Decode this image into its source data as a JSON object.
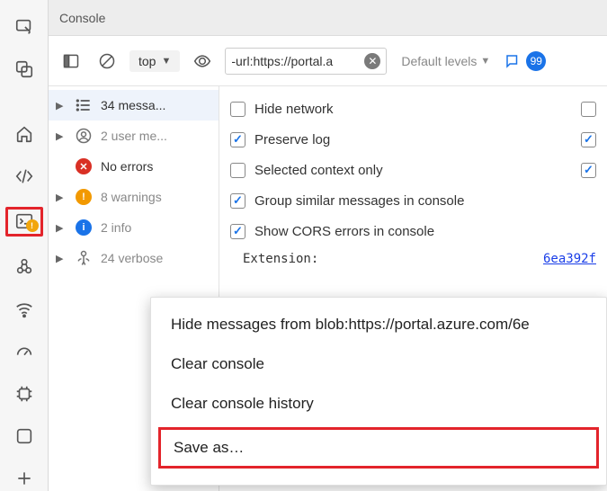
{
  "title": "Console",
  "toolbar": {
    "context": "top",
    "filter_value": "-url:https://portal.a",
    "levels_label": "Default levels",
    "issues_count": "99"
  },
  "sidebar": {
    "items": [
      {
        "label": "34 messa...",
        "kind": "all"
      },
      {
        "label": "2 user me...",
        "kind": "user"
      },
      {
        "label": "No errors",
        "kind": "error"
      },
      {
        "label": "8 warnings",
        "kind": "warning"
      },
      {
        "label": "2 info",
        "kind": "info"
      },
      {
        "label": "24 verbose",
        "kind": "verbose"
      }
    ]
  },
  "settings": {
    "hide_network": "Hide network",
    "preserve_log": "Preserve log",
    "selected_context_only": "Selected context only",
    "group_similar": "Group similar messages in console",
    "show_cors": "Show CORS errors in console",
    "extension_label": "Extension:",
    "extension_id": "6ea392f"
  },
  "context_menu": {
    "hide_from": "Hide messages from blob:https://portal.azure.com/6e",
    "clear_console": "Clear console",
    "clear_history": "Clear console history",
    "save_as": "Save as…"
  }
}
